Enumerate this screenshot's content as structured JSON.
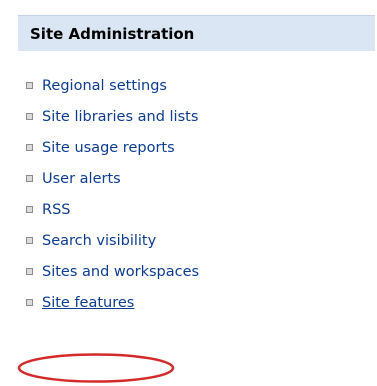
{
  "section": {
    "title": "Site Administration"
  },
  "items": [
    {
      "label": "Regional settings",
      "name": "link-regional-settings"
    },
    {
      "label": "Site libraries and lists",
      "name": "link-site-libraries-and-lists"
    },
    {
      "label": "Site usage reports",
      "name": "link-site-usage-reports"
    },
    {
      "label": "User alerts",
      "name": "link-user-alerts"
    },
    {
      "label": "RSS",
      "name": "link-rss"
    },
    {
      "label": "Search visibility",
      "name": "link-search-visibility"
    },
    {
      "label": "Sites and workspaces",
      "name": "link-sites-and-workspaces"
    },
    {
      "label": "Site features",
      "name": "link-site-features",
      "underlined": true
    }
  ],
  "colors": {
    "header_bg": "#dbe6f4",
    "link": "#0d3d8f",
    "highlight": "#d42a2a"
  }
}
